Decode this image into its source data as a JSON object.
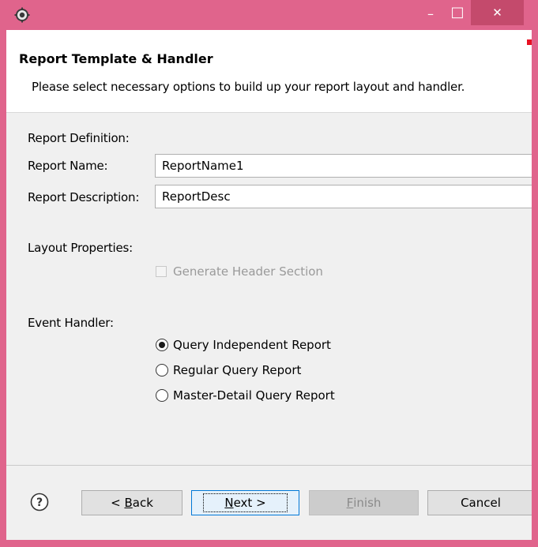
{
  "window": {
    "title_icon": "gear-icon",
    "minimize_symbol": "–",
    "maximize_symbol": "□",
    "close_symbol": "✕"
  },
  "header": {
    "title": "Report Template & Handler",
    "description": "Please select necessary options to build up your report layout and handler."
  },
  "report_definition": {
    "section_label": "Report Definition:",
    "name_label": "Report Name:",
    "name_value": "ReportName1",
    "description_label": "Report Description:",
    "description_value": "ReportDesc"
  },
  "layout_properties": {
    "section_label": "Layout Properties:",
    "generate_header_label": "Generate Header Section",
    "generate_header_checked": false,
    "generate_header_enabled": false
  },
  "event_handler": {
    "section_label": "Event Handler:",
    "options": [
      {
        "label": "Query Independent Report",
        "selected": true
      },
      {
        "label": "Regular Query Report",
        "selected": false
      },
      {
        "label": "Master-Detail Query Report",
        "selected": false
      }
    ]
  },
  "footer": {
    "help_icon": "help-icon",
    "back": {
      "prefix": "< ",
      "mnemonic": "B",
      "rest": "ack"
    },
    "next": {
      "prefix": "",
      "mnemonic": "N",
      "rest": "ext >"
    },
    "finish": {
      "prefix": "",
      "mnemonic": "F",
      "rest": "inish"
    },
    "cancel": "Cancel"
  },
  "colors": {
    "window_frame": "#e0648c",
    "close_button": "#c44a6c",
    "dialog_background": "#f0f0f0",
    "header_background": "#ffffff",
    "default_button_border": "#0078d7"
  }
}
